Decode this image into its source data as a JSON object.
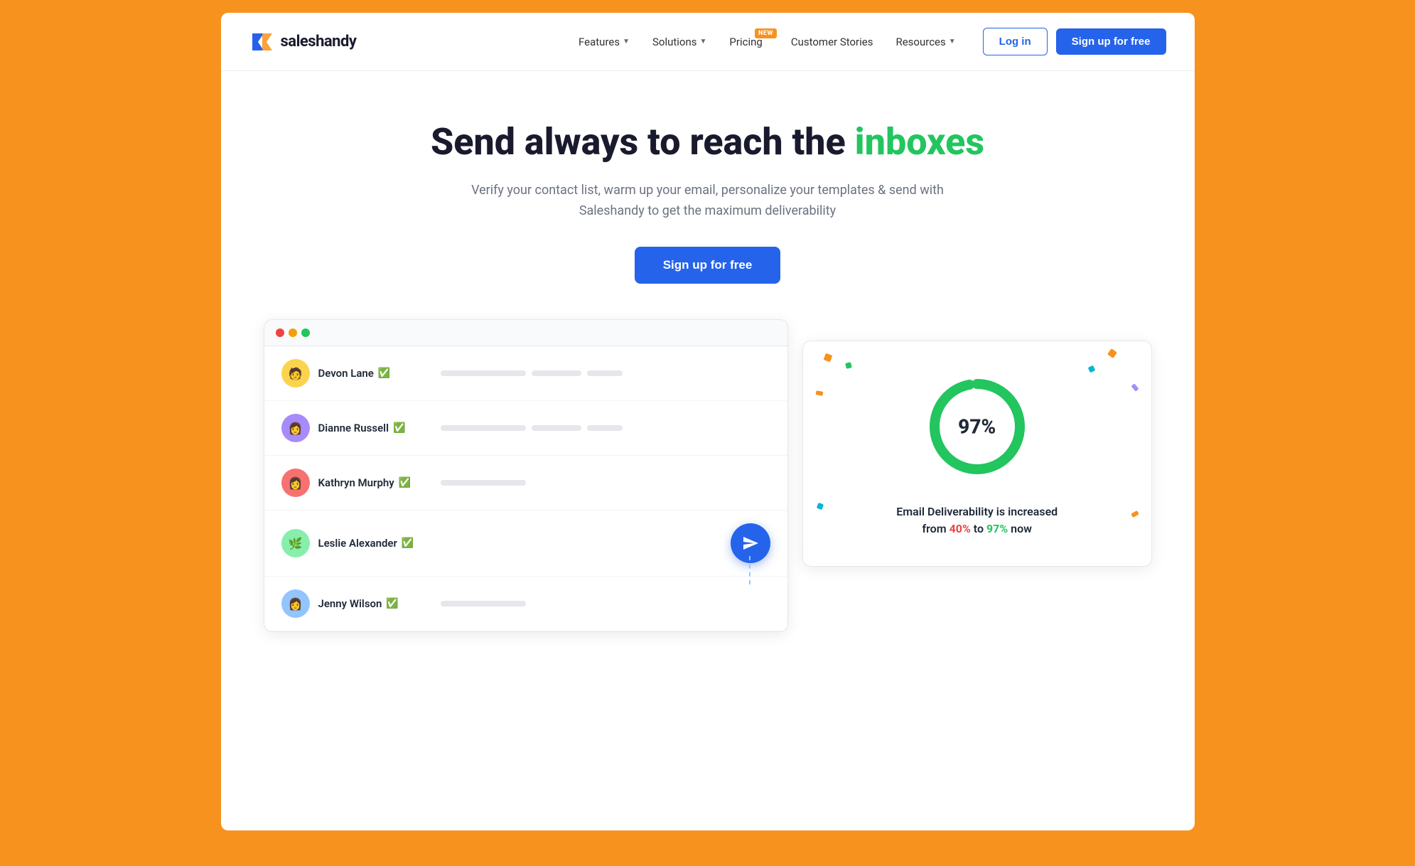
{
  "nav": {
    "logo_text": "saleshandy",
    "items": [
      {
        "label": "Features",
        "has_dropdown": true
      },
      {
        "label": "Solutions",
        "has_dropdown": true
      },
      {
        "label": "Pricing",
        "has_dropdown": false,
        "badge": "NEW"
      },
      {
        "label": "Customer Stories",
        "has_dropdown": false
      },
      {
        "label": "Resources",
        "has_dropdown": true
      }
    ],
    "login_label": "Log in",
    "signup_label": "Sign up for free"
  },
  "hero": {
    "headline_part1": "Send always to reach the ",
    "headline_highlight": "inboxes",
    "subtext": "Verify your contact list, warm up your email, personalize your templates & send with Saleshandy to get the maximum deliverability",
    "cta_label": "Sign up for free"
  },
  "mockup": {
    "contacts": [
      {
        "name": "Devon Lane",
        "verified": true,
        "avatar_emoji": "🧑",
        "avatar_class": "avatar-devon"
      },
      {
        "name": "Dianne Russell",
        "verified": true,
        "avatar_emoji": "👩",
        "avatar_class": "avatar-dianne"
      },
      {
        "name": "Kathryn Murphy",
        "verified": true,
        "avatar_emoji": "👩",
        "avatar_class": "avatar-kathryn"
      },
      {
        "name": "Leslie Alexander",
        "verified": true,
        "avatar_emoji": "🌿",
        "avatar_class": "avatar-leslie",
        "show_send": true
      },
      {
        "name": "Jenny Wilson",
        "verified": true,
        "avatar_emoji": "👩",
        "avatar_class": "avatar-jenny"
      }
    ]
  },
  "stats": {
    "percentage": "97%",
    "description_before": "Email Deliverability is increased\nfrom ",
    "from_pct": "40%",
    "description_middle": " to ",
    "to_pct": "97%",
    "description_after": " now",
    "donut_percentage": 97,
    "donut_color": "#22c55e",
    "donut_bg": "#e5e7eb"
  },
  "colors": {
    "brand_orange": "#F7921E",
    "brand_blue": "#2563eb",
    "brand_green": "#22c55e"
  }
}
